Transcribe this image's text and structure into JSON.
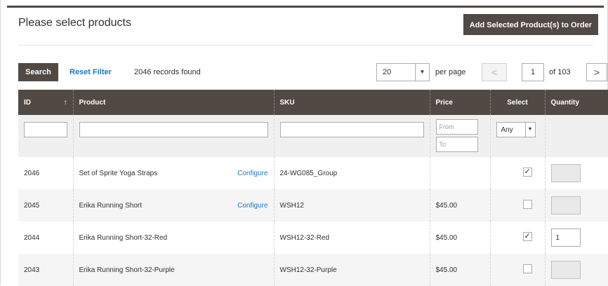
{
  "header": {
    "title": "Please select products",
    "add_button": "Add Selected Product(s) to Order"
  },
  "toolbar": {
    "search_label": "Search",
    "reset_label": "Reset Filter",
    "records": "2046 records found",
    "per_page_value": "20",
    "per_page_label": "per page",
    "prev_symbol": "<",
    "page_value": "1",
    "page_of": "of 103",
    "next_symbol": ">"
  },
  "columns": {
    "id": "ID",
    "sort_symbol": "↑",
    "product": "Product",
    "sku": "SKU",
    "price": "Price",
    "select": "Select",
    "quantity": "Quantity"
  },
  "filters": {
    "price_from": "From",
    "price_to": "To",
    "select_value": "Any"
  },
  "rows": [
    {
      "id": "2046",
      "product": "Set of Sprite Yoga Straps",
      "action": "Configure",
      "sku": "24-WG085_Group",
      "price": "",
      "checked": true,
      "qty": ""
    },
    {
      "id": "2045",
      "product": "Erika Running Short",
      "action": "Configure",
      "sku": "WSH12",
      "price": "$45.00",
      "checked": false,
      "qty": ""
    },
    {
      "id": "2044",
      "product": "Erika Running Short-32-Red",
      "action": "",
      "sku": "WSH12-32-Red",
      "price": "$45.00",
      "checked": true,
      "qty": "1"
    },
    {
      "id": "2043",
      "product": "Erika Running Short-32-Purple",
      "action": "",
      "sku": "WSH12-32-Purple",
      "price": "$45.00",
      "checked": false,
      "qty": ""
    }
  ]
}
